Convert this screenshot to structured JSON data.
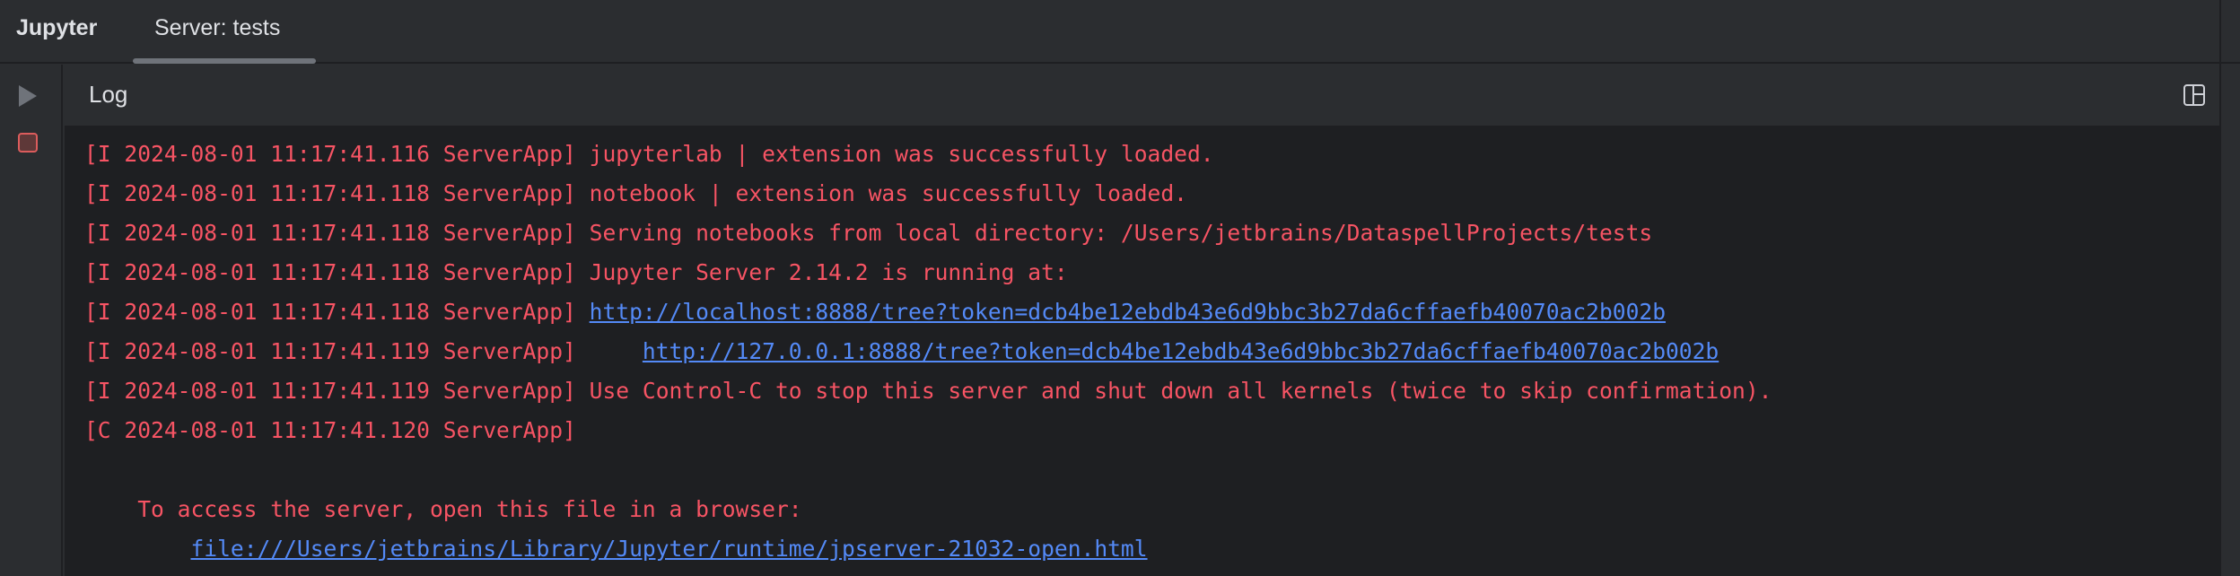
{
  "app": {
    "title": "Jupyter"
  },
  "tabs": [
    {
      "label": "Server: tests",
      "active": true
    }
  ],
  "toolbar": {
    "run_icon": "play-icon",
    "stop_icon": "stop-icon"
  },
  "panel": {
    "title": "Log",
    "layout_icon": "layout-icon"
  },
  "colors": {
    "log_text": "#f75464",
    "link": "#548af7",
    "console_bg": "#1e1f22",
    "chrome_bg": "#2b2d30"
  },
  "log": [
    {
      "prefix": "[I 2024-08-01 11:17:41.116 ServerApp] ",
      "text": "jupyterlab | extension was successfully loaded."
    },
    {
      "prefix": "[I 2024-08-01 11:17:41.118 ServerApp] ",
      "text": "notebook | extension was successfully loaded."
    },
    {
      "prefix": "[I 2024-08-01 11:17:41.118 ServerApp] ",
      "text": "Serving notebooks from local directory: /Users/jetbrains/DataspellProjects/tests"
    },
    {
      "prefix": "[I 2024-08-01 11:17:41.118 ServerApp] ",
      "text": "Jupyter Server 2.14.2 is running at:"
    },
    {
      "prefix": "[I 2024-08-01 11:17:41.118 ServerApp] ",
      "link": "http://localhost:8888/tree?token=dcb4be12ebdb43e6d9bbc3b27da6cffaefb40070ac2b002b"
    },
    {
      "prefix": "[I 2024-08-01 11:17:41.119 ServerApp]     ",
      "link": "http://127.0.0.1:8888/tree?token=dcb4be12ebdb43e6d9bbc3b27da6cffaefb40070ac2b002b"
    },
    {
      "prefix": "[I 2024-08-01 11:17:41.119 ServerApp] ",
      "text": "Use Control-C to stop this server and shut down all kernels (twice to skip confirmation)."
    },
    {
      "prefix": "[C 2024-08-01 11:17:41.120 ServerApp]",
      "text": ""
    }
  ],
  "access": {
    "message": "    To access the server, open this file in a browser:",
    "indent": "        ",
    "file_link": "file:///Users/jetbrains/Library/Jupyter/runtime/jpserver-21032-open.html"
  }
}
